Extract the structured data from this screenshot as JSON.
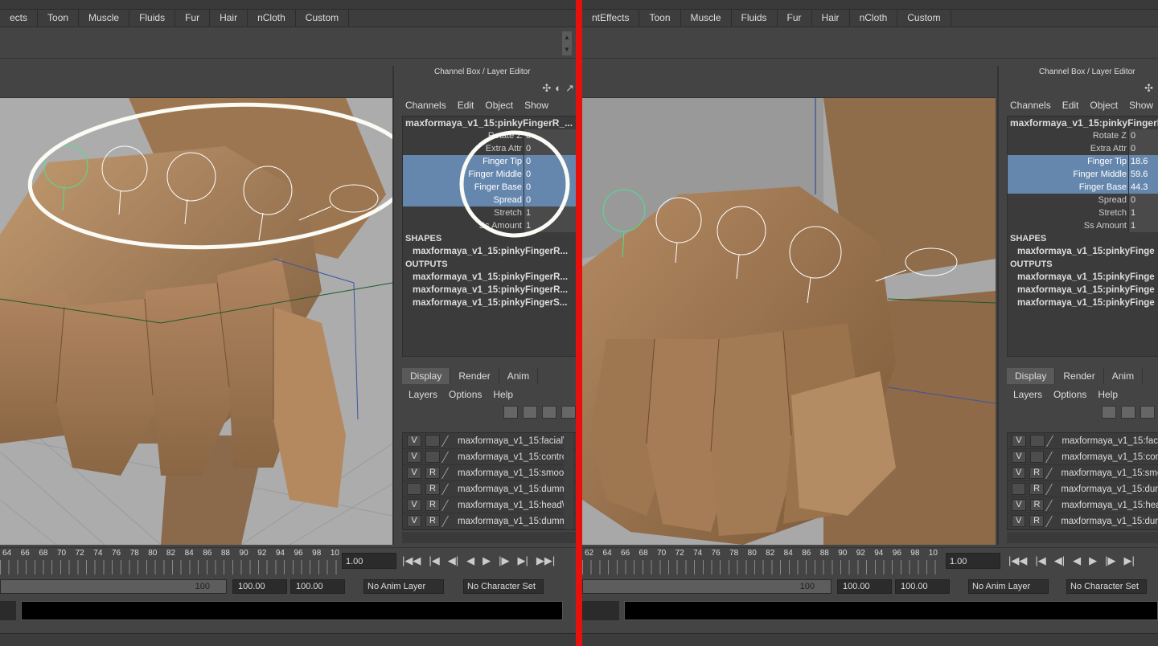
{
  "left": {
    "shelf_tabs": [
      "ects",
      "Toon",
      "Muscle",
      "Fluids",
      "Fur",
      "Hair",
      "nCloth",
      "Custom"
    ],
    "channel_box": {
      "title": "Channel Box / Layer Editor",
      "menu": [
        "Channels",
        "Edit",
        "Object",
        "Show"
      ],
      "object_name": "maxformaya_v1_15:pinkyFingerR_...",
      "attributes": [
        {
          "name": "Rotate Z",
          "value": "0",
          "selected": false
        },
        {
          "name": "Extra Attr",
          "value": "0",
          "selected": false
        },
        {
          "name": "Finger Tip",
          "value": "0",
          "selected": true
        },
        {
          "name": "Finger Middle",
          "value": "0",
          "selected": true
        },
        {
          "name": "Finger Base",
          "value": "0",
          "selected": true
        },
        {
          "name": "Spread",
          "value": "0",
          "selected": true
        },
        {
          "name": "Stretch",
          "value": "1",
          "selected": false
        },
        {
          "name": "Ss Amount",
          "value": "1",
          "selected": false
        }
      ],
      "shapes_label": "SHAPES",
      "shapes": [
        "maxformaya_v1_15:pinkyFingerR..."
      ],
      "outputs_label": "OUTPUTS",
      "outputs": [
        "maxformaya_v1_15:pinkyFingerR...",
        "maxformaya_v1_15:pinkyFingerR...",
        "maxformaya_v1_15:pinkyFingerS..."
      ]
    },
    "layer_editor": {
      "tabs": [
        "Display",
        "Render",
        "Anim"
      ],
      "menu": [
        "Layers",
        "Options",
        "Help"
      ],
      "layers": [
        {
          "v": "V",
          "r": "",
          "name": "maxformaya_v1_15:facial\\"
        },
        {
          "v": "V",
          "r": "",
          "name": "maxformaya_v1_15:contro"
        },
        {
          "v": "V",
          "r": "R",
          "name": "maxformaya_v1_15:smoot"
        },
        {
          "v": "",
          "r": "R",
          "name": "maxformaya_v1_15:dumm"
        },
        {
          "v": "V",
          "r": "R",
          "name": "maxformaya_v1_15:head\\"
        },
        {
          "v": "V",
          "r": "R",
          "name": "maxformaya_v1_15:dumm"
        }
      ]
    },
    "time": {
      "ticks": [
        "64",
        "66",
        "68",
        "70",
        "72",
        "74",
        "76",
        "78",
        "80",
        "82",
        "84",
        "86",
        "88",
        "90",
        "92",
        "94",
        "96",
        "98",
        "10"
      ],
      "current_frame": "1.00",
      "range_end": "100",
      "start_field": "100.00",
      "end_field": "100.00",
      "anim_layer": "No Anim Layer",
      "char_set": "No Character Set"
    }
  },
  "right": {
    "shelf_tabs": [
      "ntEffects",
      "Toon",
      "Muscle",
      "Fluids",
      "Fur",
      "Hair",
      "nCloth",
      "Custom"
    ],
    "channel_box": {
      "title": "Channel Box / Layer Editor",
      "menu": [
        "Channels",
        "Edit",
        "Object",
        "Show"
      ],
      "object_name": "maxformaya_v1_15:pinkyFingerR",
      "attributes": [
        {
          "name": "Rotate Z",
          "value": "0",
          "selected": false
        },
        {
          "name": "Extra Attr",
          "value": "0",
          "selected": false
        },
        {
          "name": "Finger Tip",
          "value": "18.6",
          "selected": true
        },
        {
          "name": "Finger Middle",
          "value": "59.6",
          "selected": true
        },
        {
          "name": "Finger Base",
          "value": "44.3",
          "selected": true
        },
        {
          "name": "Spread",
          "value": "0",
          "selected": false
        },
        {
          "name": "Stretch",
          "value": "1",
          "selected": false
        },
        {
          "name": "Ss Amount",
          "value": "1",
          "selected": false
        }
      ],
      "shapes_label": "SHAPES",
      "shapes": [
        "maxformaya_v1_15:pinkyFinge"
      ],
      "outputs_label": "OUTPUTS",
      "outputs": [
        "maxformaya_v1_15:pinkyFinge",
        "maxformaya_v1_15:pinkyFinge",
        "maxformaya_v1_15:pinkyFinge"
      ]
    },
    "layer_editor": {
      "tabs": [
        "Display",
        "Render",
        "Anim"
      ],
      "menu": [
        "Layers",
        "Options",
        "Help"
      ],
      "layers": [
        {
          "v": "V",
          "r": "",
          "name": "maxformaya_v1_15:faci"
        },
        {
          "v": "V",
          "r": "",
          "name": "maxformaya_v1_15:con"
        },
        {
          "v": "V",
          "r": "R",
          "name": "maxformaya_v1_15:smo"
        },
        {
          "v": "",
          "r": "R",
          "name": "maxformaya_v1_15:dum"
        },
        {
          "v": "V",
          "r": "R",
          "name": "maxformaya_v1_15:hea"
        },
        {
          "v": "V",
          "r": "R",
          "name": "maxformaya_v1_15:dum"
        }
      ]
    },
    "time": {
      "ticks": [
        "62",
        "64",
        "66",
        "68",
        "70",
        "72",
        "74",
        "76",
        "78",
        "80",
        "82",
        "84",
        "86",
        "88",
        "90",
        "92",
        "94",
        "96",
        "98",
        "10"
      ],
      "current_frame": "1.00",
      "range_end": "100",
      "start_field": "100.00",
      "end_field": "100.00",
      "anim_layer": "No Anim Layer",
      "char_set": "No Character Set"
    }
  },
  "colors": {
    "divider": "#e8100c",
    "selected_attr": "#6687ad",
    "skin": "#a07a55",
    "control_curve": "#ffffff",
    "annotation": "#ffffff"
  }
}
